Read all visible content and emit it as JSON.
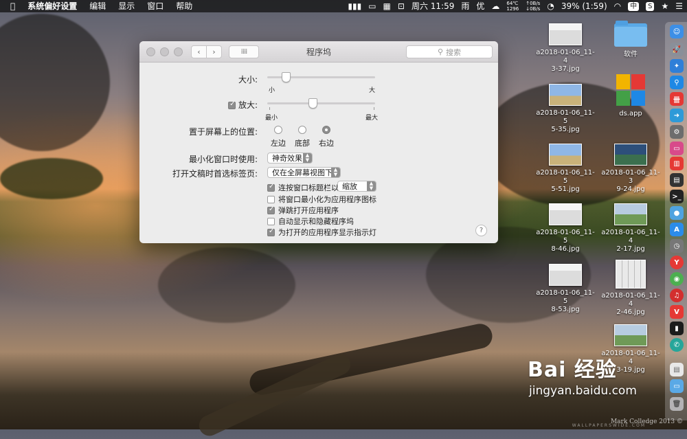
{
  "menubar": {
    "app": "系统偏好设置",
    "items": [
      "编辑",
      "显示",
      "窗口",
      "帮助"
    ],
    "status": {
      "datetime": "周六 11:59",
      "rain": "雨",
      "you": "优",
      "temp_top": "64℃",
      "temp_bottom": "1296",
      "net_up": "↑0B/s",
      "net_down": "↓0B/s",
      "battery": "39% (1:59)",
      "ime": "中",
      "s_badge": "S"
    }
  },
  "window": {
    "title": "程序坞",
    "search_placeholder": "搜索",
    "size": {
      "label": "大小:",
      "min": "小",
      "max": "大",
      "value": 0.17
    },
    "magnify": {
      "label": "放大:",
      "checked": true,
      "min": "最小",
      "max": "最大",
      "value": 0.42
    },
    "position": {
      "label": "置于屏幕上的位置:",
      "options": [
        "左边",
        "底部",
        "右边"
      ],
      "selected": "右边"
    },
    "minimize": {
      "label": "最小化窗口时使用:",
      "value": "神奇效果"
    },
    "tabs": {
      "label": "打开文稿时首选标签页:",
      "value": "仅在全屏幕视图下"
    },
    "options": [
      {
        "label": "连按窗口标题栏以",
        "checked": true,
        "popup": "缩放"
      },
      {
        "label": "将窗口最小化为应用程序图标",
        "checked": false
      },
      {
        "label": "弹跳打开应用程序",
        "checked": true
      },
      {
        "label": "自动显示和隐藏程序坞",
        "checked": false
      },
      {
        "label": "为打开的应用程序显示指示灯",
        "checked": true
      }
    ],
    "help": "?"
  },
  "desktop": {
    "icons": [
      {
        "name": "a2018-01-06_11-43-37.jpg",
        "line1": "a2018-01-06_11-4",
        "line2": "3-37.jpg"
      },
      {
        "name": "软件",
        "line1": "软件",
        "line2": ""
      },
      {
        "name": "a2018-01-06_11-55-35.jpg",
        "line1": "a2018-01-06_11-5",
        "line2": "5-35.jpg"
      },
      {
        "name": "ds.app",
        "line1": "ds.app",
        "line2": ""
      },
      {
        "name": "a2018-01-06_11-55-51.jpg",
        "line1": "a2018-01-06_11-5",
        "line2": "5-51.jpg"
      },
      {
        "name": "a2018-01-06_11-39-24.jpg",
        "line1": "a2018-01-06_11-3",
        "line2": "9-24.jpg"
      },
      {
        "name": "a2018-01-06_11-58-46.jpg",
        "line1": "a2018-01-06_11-5",
        "line2": "8-46.jpg"
      },
      {
        "name": "a2018-01-06_11-42-17.jpg",
        "line1": "a2018-01-06_11-4",
        "line2": "2-17.jpg"
      },
      {
        "name": "a2018-01-06_11-58-53.jpg",
        "line1": "a2018-01-06_11-5",
        "line2": "8-53.jpg"
      },
      {
        "name": "a2018-01-06_11-42-46.jpg",
        "line1": "a2018-01-06_11-4",
        "line2": "2-46.jpg"
      },
      {
        "name": "a2018-01-06_11-43-19.jpg",
        "line1": "a2018-01-06_11-4",
        "line2": "3-19.jpg"
      }
    ]
  },
  "watermark": {
    "brand": "Bai 经验",
    "url": "jingyan.baidu.com",
    "credit": "Mark Colledge 2013 ©",
    "site": "WALLPAPERSWIDE.COM"
  },
  "colors": {
    "accent": "#8e8e8e",
    "menubar": "#1c1c1e"
  }
}
